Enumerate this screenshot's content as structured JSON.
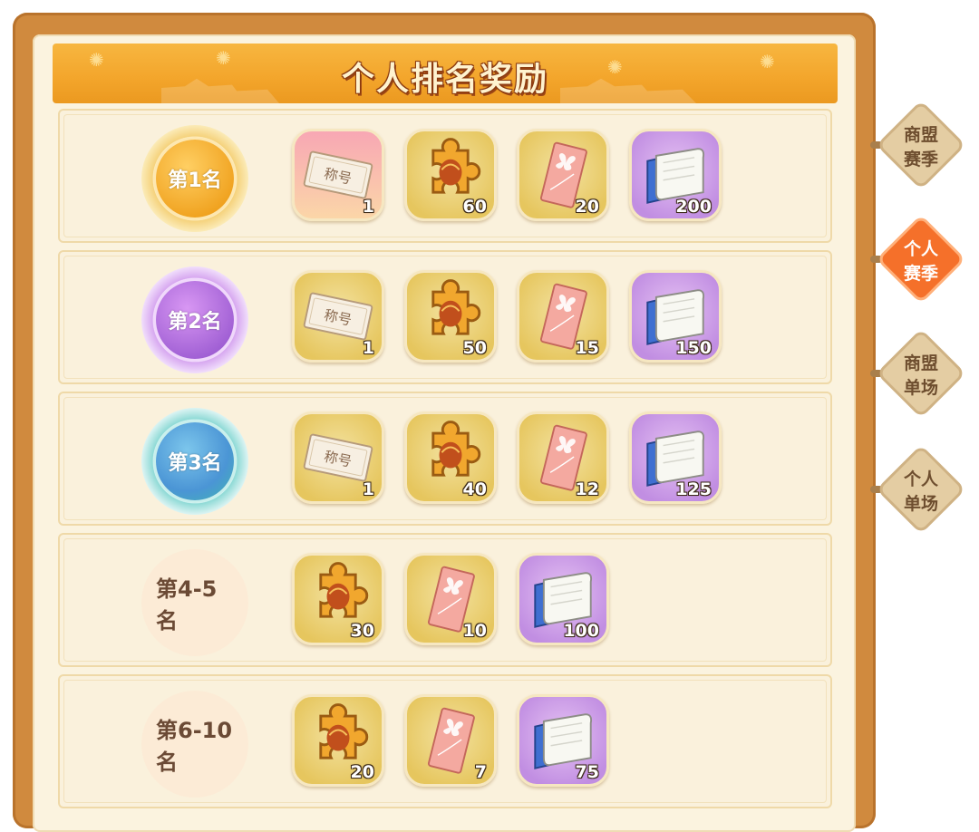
{
  "title": "个人排名奖励",
  "item_types": {
    "title_card": {
      "label": "称号",
      "icon": "title-card-icon"
    },
    "puzzle": {
      "icon": "puzzle-piece-icon"
    },
    "ticket": {
      "icon": "butterfly-ticket-icon"
    },
    "scroll": {
      "icon": "scroll-book-icon"
    }
  },
  "rows": [
    {
      "rank": "第1名",
      "style": "gold",
      "rewards": [
        {
          "type": "title_card",
          "bg": "pink",
          "count": "1"
        },
        {
          "type": "puzzle",
          "bg": "gold",
          "count": "60"
        },
        {
          "type": "ticket",
          "bg": "gold",
          "count": "20"
        },
        {
          "type": "scroll",
          "bg": "purple",
          "count": "200"
        }
      ]
    },
    {
      "rank": "第2名",
      "style": "purple",
      "rewards": [
        {
          "type": "title_card",
          "bg": "gold",
          "count": "1"
        },
        {
          "type": "puzzle",
          "bg": "gold",
          "count": "50"
        },
        {
          "type": "ticket",
          "bg": "gold",
          "count": "15"
        },
        {
          "type": "scroll",
          "bg": "purple",
          "count": "150"
        }
      ]
    },
    {
      "rank": "第3名",
      "style": "teal",
      "rewards": [
        {
          "type": "title_card",
          "bg": "gold",
          "count": "1"
        },
        {
          "type": "puzzle",
          "bg": "gold",
          "count": "40"
        },
        {
          "type": "ticket",
          "bg": "gold",
          "count": "12"
        },
        {
          "type": "scroll",
          "bg": "purple",
          "count": "125"
        }
      ]
    },
    {
      "rank": "第4-5名",
      "style": "plain",
      "rewards": [
        {
          "type": "puzzle",
          "bg": "gold",
          "count": "30"
        },
        {
          "type": "ticket",
          "bg": "gold",
          "count": "10"
        },
        {
          "type": "scroll",
          "bg": "purple",
          "count": "100"
        }
      ]
    },
    {
      "rank": "第6-10名",
      "style": "plain",
      "rewards": [
        {
          "type": "puzzle",
          "bg": "gold",
          "count": "20"
        },
        {
          "type": "ticket",
          "bg": "gold",
          "count": "7"
        },
        {
          "type": "scroll",
          "bg": "purple",
          "count": "75"
        }
      ]
    }
  ],
  "tabs": [
    {
      "label": "商盟\n赛季",
      "active": false
    },
    {
      "label": "个人\n赛季",
      "active": true
    },
    {
      "label": "商盟\n单场",
      "active": false
    },
    {
      "label": "个人\n单场",
      "active": false
    }
  ],
  "colors": {
    "frame": "#d08a3e",
    "banner": "#f3a52b",
    "active_tab": "#f5702a"
  }
}
